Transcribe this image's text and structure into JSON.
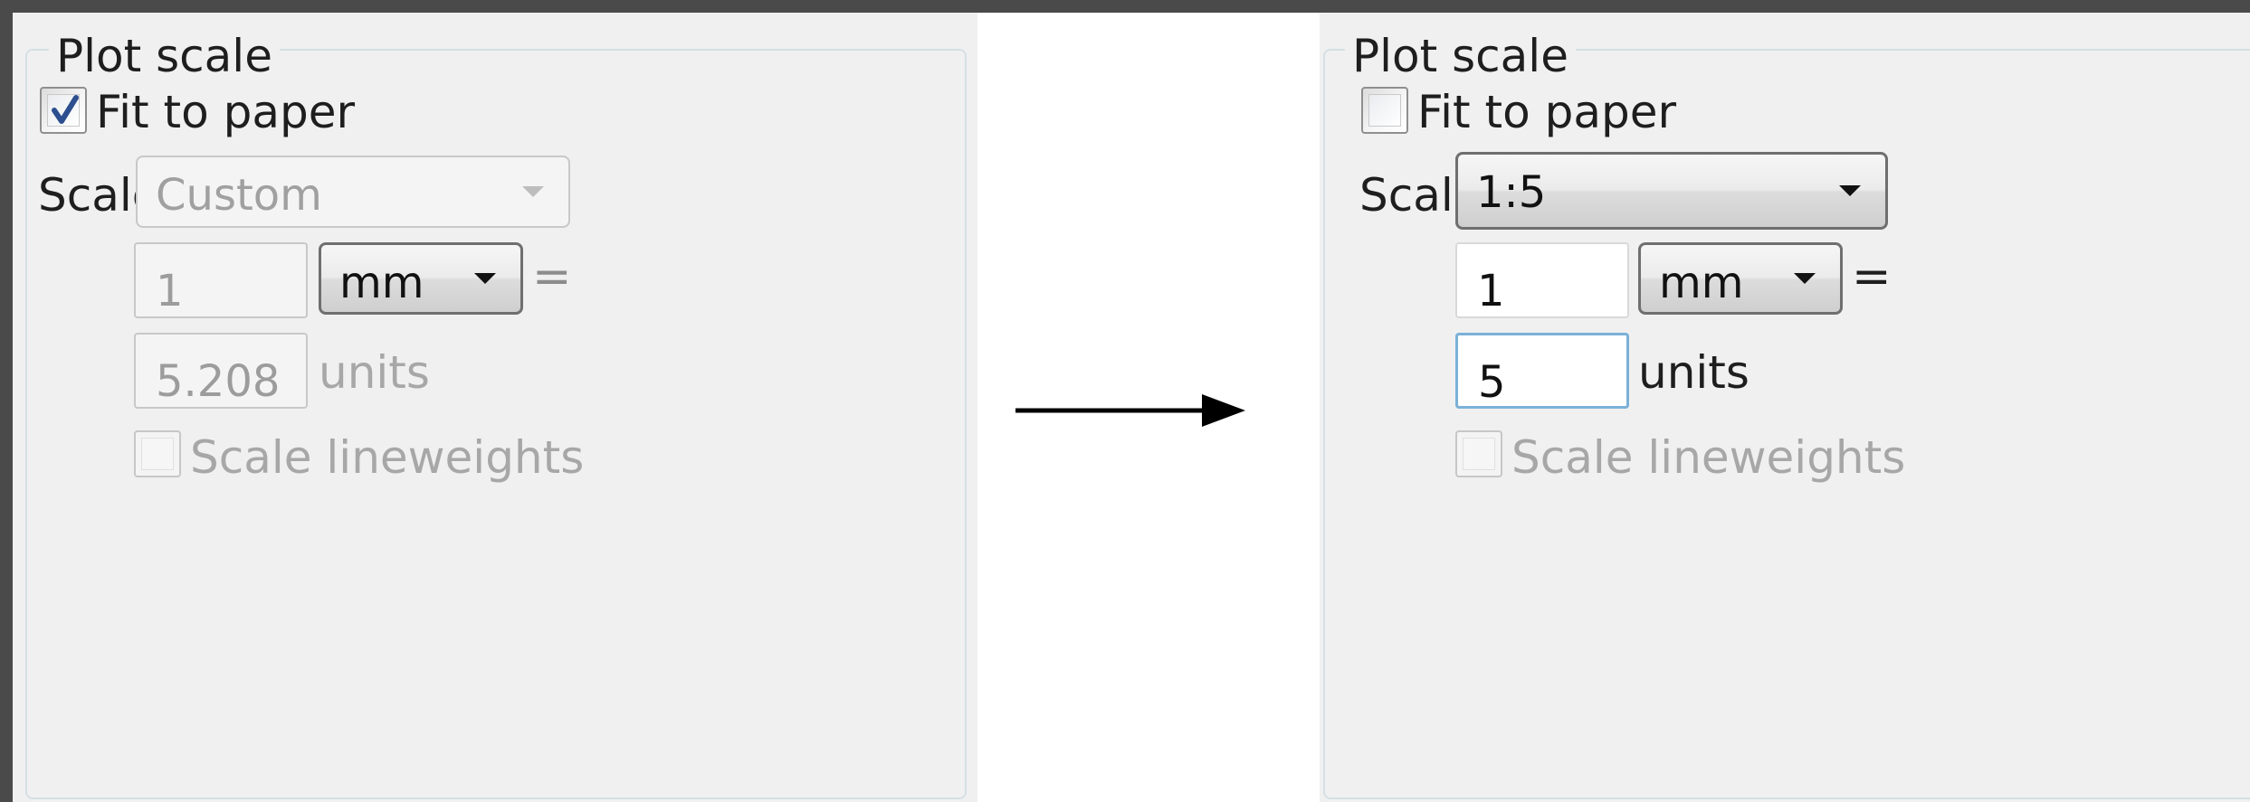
{
  "before": {
    "group_title": "Plot scale",
    "fit_to_paper": {
      "label": "Fit to paper",
      "checked": true
    },
    "scale": {
      "label": "Scale:",
      "value": "Custom",
      "enabled": false
    },
    "paper_value": "1",
    "paper_unit": "mm",
    "equals": "=",
    "drawing_value": "5.208",
    "drawing_unit_label": "units",
    "scale_lineweights": {
      "label": "Scale lineweights",
      "checked": false,
      "enabled": false
    }
  },
  "after": {
    "group_title": "Plot scale",
    "fit_to_paper": {
      "label": "Fit to paper",
      "checked": false
    },
    "scale": {
      "label": "Scale:",
      "value": "1:5",
      "enabled": true
    },
    "paper_value": "1",
    "paper_unit": "mm",
    "equals": "=",
    "drawing_value": "5",
    "drawing_unit_label": "units",
    "scale_lineweights": {
      "label": "Scale lineweights",
      "checked": false,
      "enabled": false
    }
  },
  "transition_icon": "right-arrow-icon",
  "colors": {
    "panel_bg": "#f0f0f0",
    "frame_bg": "#4a4a4a",
    "disabled_text": "#a7a7a7",
    "focus_border": "#7ab1d8"
  }
}
